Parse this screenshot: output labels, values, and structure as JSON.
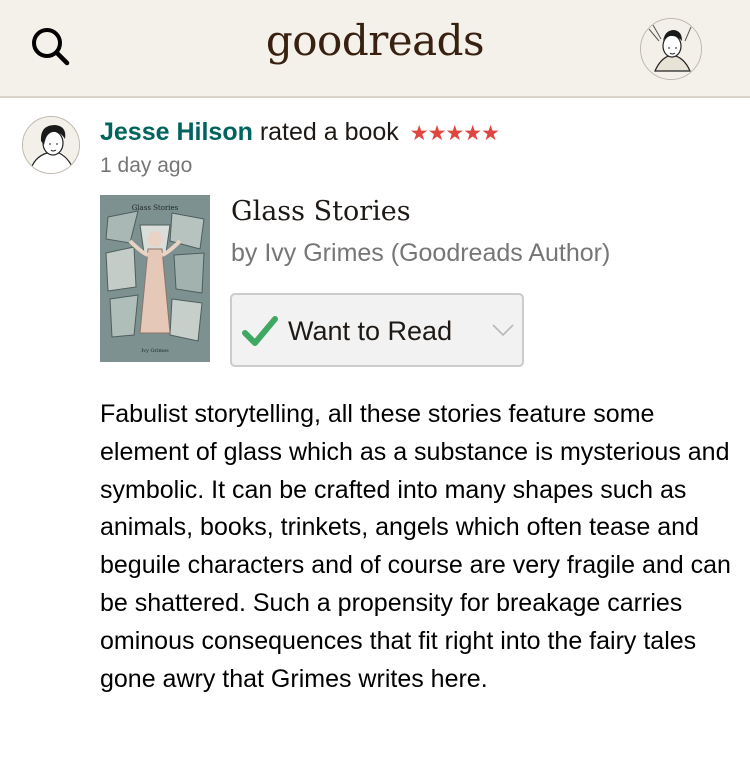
{
  "header": {
    "logo": "goodreads",
    "icons": {
      "search": "search-icon",
      "profile": "avatar"
    }
  },
  "post": {
    "user_name": "Jesse Hilson",
    "action": "rated a book",
    "rating": 5,
    "stars": "★★★★★",
    "timestamp": "1 day ago"
  },
  "book": {
    "title": "Glass Stories",
    "author": "by Ivy Grimes (Goodreads Author)",
    "cover_title": "Glass Stories",
    "cover_author": "Ivy Grimes",
    "shelf_button": "Want to Read"
  },
  "review": {
    "text": "Fabulist storytelling, all these stories feature some element of glass which as a substance is mysterious and symbolic. It can be crafted into many shapes such as animals, books, trinkets, angels which often tease and beguile characters and of course are very fragile and can be shattered. Such a propensity for breakage carries ominous consequences that fit right into the fairy tales gone awry that Grimes writes here."
  },
  "colors": {
    "header_bg": "#f4f1ea",
    "logo": "#382110",
    "link": "#00635d",
    "star": "#e0463f",
    "check": "#3fa863",
    "muted": "#767676"
  }
}
